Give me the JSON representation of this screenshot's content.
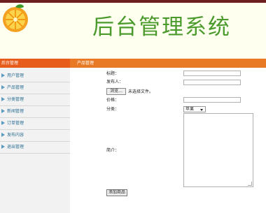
{
  "header": {
    "title": "后台管理系统"
  },
  "sidebar": {
    "heading": "后台管理",
    "items": [
      {
        "label": "用户管理"
      },
      {
        "label": "产品管理"
      },
      {
        "label": "分类管理"
      },
      {
        "label": "新闻管理"
      },
      {
        "label": "订单管理"
      },
      {
        "label": "发布内容"
      },
      {
        "label": "退出管理"
      }
    ]
  },
  "main": {
    "heading": "产品管理",
    "form": {
      "title_label": "标题：",
      "publisher_label": "发布人：",
      "file_button": "浏览...",
      "file_status": "未选择文件。",
      "price_label": "价格：",
      "category_label": "分类：",
      "category_value": "苹果",
      "intro_label": "简介：",
      "submit_label": "添加商品"
    }
  },
  "colors": {
    "accent_orange": "#e87a25",
    "title_green": "#4a9a2c",
    "topbar": "#6e1f1f"
  }
}
